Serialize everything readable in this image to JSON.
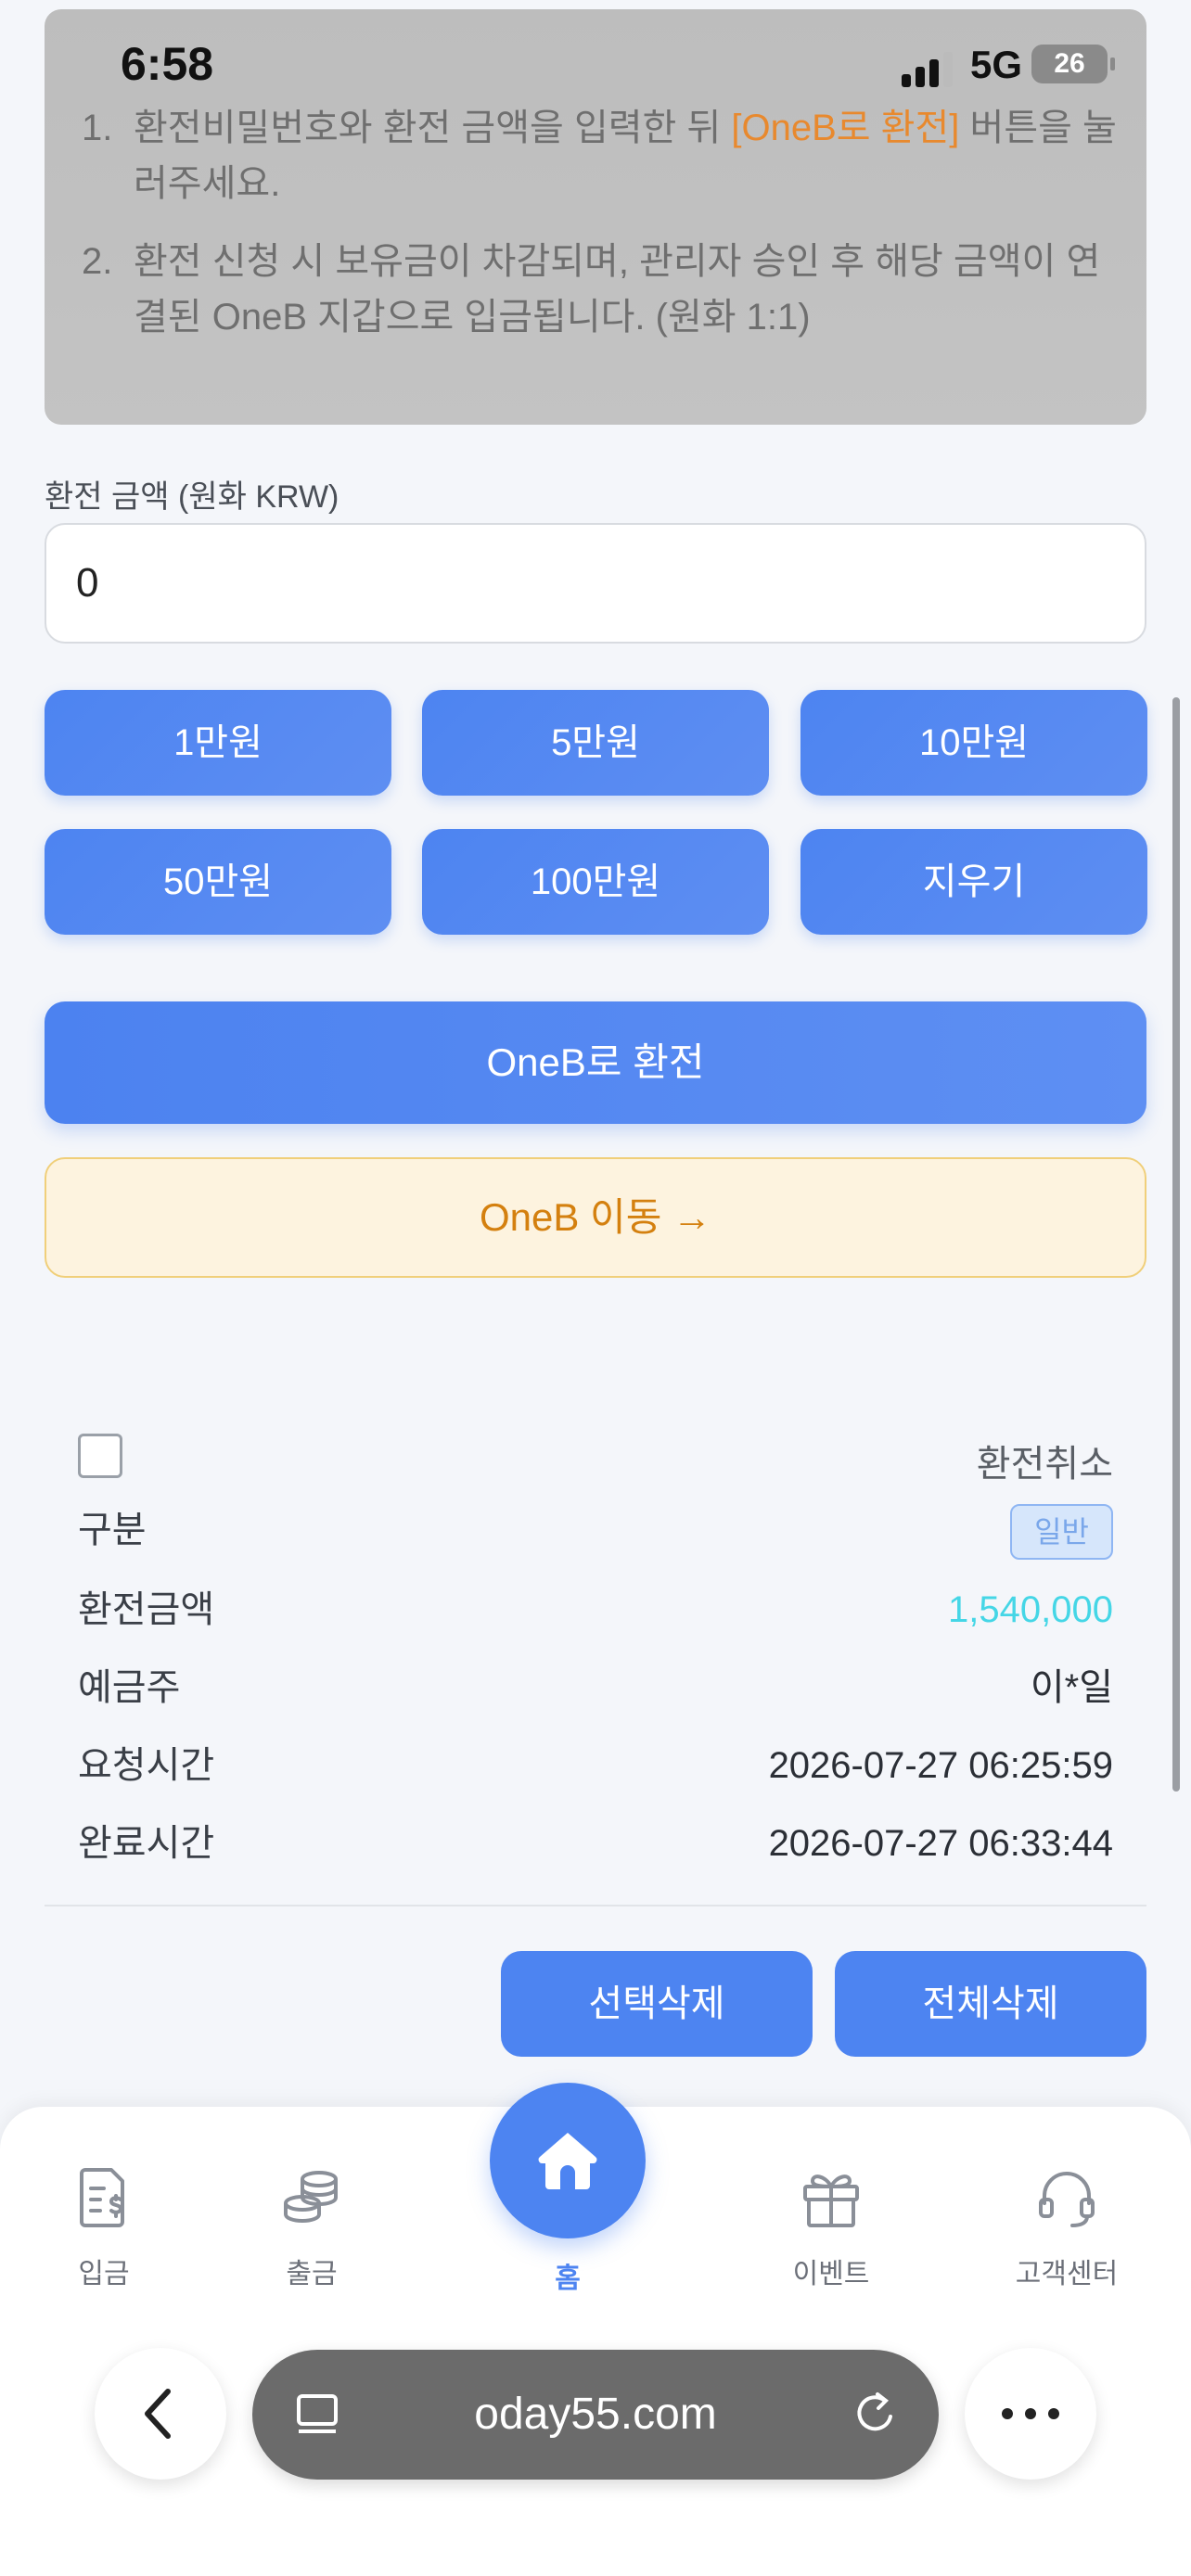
{
  "status_bar": {
    "time": "6:58",
    "network": "5G",
    "battery": "26"
  },
  "notice": {
    "items": [
      {
        "num": "1.",
        "before": "환전비밀번호와 환전 금액을 입력한 뒤 ",
        "highlight": "[OneB로 환전]",
        "after": " 버튼을 눌러주세요."
      },
      {
        "num": "2.",
        "text": "환전 신청 시 보유금이 차감되며, 관리자 승인 후 해당 금액이 연결된 OneB 지갑으로 입금됩니다. (원화 1:1)"
      }
    ]
  },
  "amount": {
    "label": "환전 금액 (원화 KRW)",
    "value": "0"
  },
  "quick_buttons": [
    "1만원",
    "5만원",
    "10만원",
    "50만원",
    "100만원",
    "지우기"
  ],
  "primary_button": "OneB로 환전",
  "move_button": "OneB 이동 →",
  "record": {
    "cancel_label": "환전취소",
    "rows": [
      {
        "key": "구분",
        "value": "일반"
      },
      {
        "key": "환전금액",
        "value": "1,540,000"
      },
      {
        "key": "예금주",
        "value": "이*일"
      },
      {
        "key": "요청시간",
        "value": "2026-07-27 06:25:59"
      },
      {
        "key": "완료시간",
        "value": "2026-07-27 06:33:44"
      }
    ]
  },
  "actions": {
    "delete_selected": "선택삭제",
    "delete_all": "전체삭제"
  },
  "bottom_nav": {
    "items": [
      {
        "label": "입금",
        "icon": "deposit-icon"
      },
      {
        "label": "출금",
        "icon": "coins-icon"
      },
      {
        "label": "홈",
        "icon": "home-icon"
      },
      {
        "label": "이벤트",
        "icon": "gift-icon"
      },
      {
        "label": "고객센터",
        "icon": "headset-icon"
      }
    ]
  },
  "browser": {
    "url": "oday55.com"
  },
  "colors": {
    "accent": "#4d84f1",
    "warning": "#d4800f",
    "amount": "#45d6e6"
  }
}
